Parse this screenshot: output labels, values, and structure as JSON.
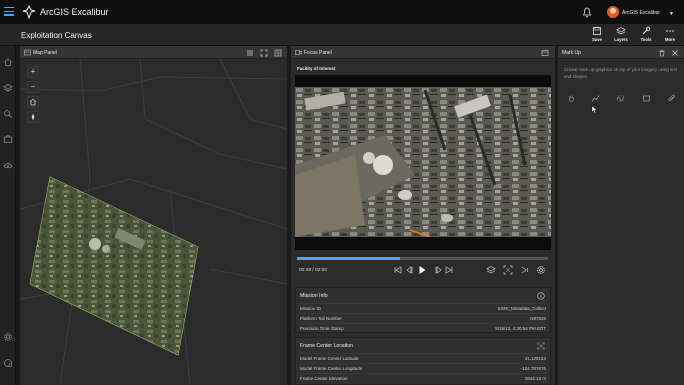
{
  "app": {
    "name": "ArcGIS Excalibur"
  },
  "user": {
    "name": "ArcGIS Excalibur"
  },
  "page": {
    "title": "Exploitation Canvas"
  },
  "toolbar": [
    {
      "label": "Save",
      "icon": "save-icon"
    },
    {
      "label": "Layers",
      "icon": "layers-icon"
    },
    {
      "label": "Tools",
      "icon": "tools-icon"
    },
    {
      "label": "More",
      "icon": "more-icon"
    }
  ],
  "map_panel": {
    "title": "Map Panel"
  },
  "focus_panel": {
    "title": "Focus Panel",
    "subtitle": "Facility of Interest",
    "time": "00:49 / 02:00",
    "progress": 0.41
  },
  "mission_info": {
    "title": "Mission Info",
    "rows": [
      {
        "key": "Mission ID",
        "value": "ESRI_Metadata_Collect"
      },
      {
        "key": "Platform Tail Number",
        "value": "N97826"
      },
      {
        "key": "Precision Time Stamp",
        "value": "9/19/12, 4:30:54 PM EDT"
      }
    ]
  },
  "frame_center": {
    "title": "Frame Center Location",
    "rows": [
      {
        "key": "Model Frame Center Latitude",
        "value": "41.129153"
      },
      {
        "key": "Model Frame Center Longitude",
        "value": "-104.767676"
      },
      {
        "key": "Frame Center Elevation",
        "value": "1844.13 m"
      }
    ]
  },
  "markup_panel": {
    "title": "Mark Up",
    "description": "Create mark up graphics on top of your imagery using text and shapes."
  },
  "colors": {
    "accent": "#4aa3ff",
    "footprint": "#b8d27a",
    "background": "#1a1a1a"
  }
}
